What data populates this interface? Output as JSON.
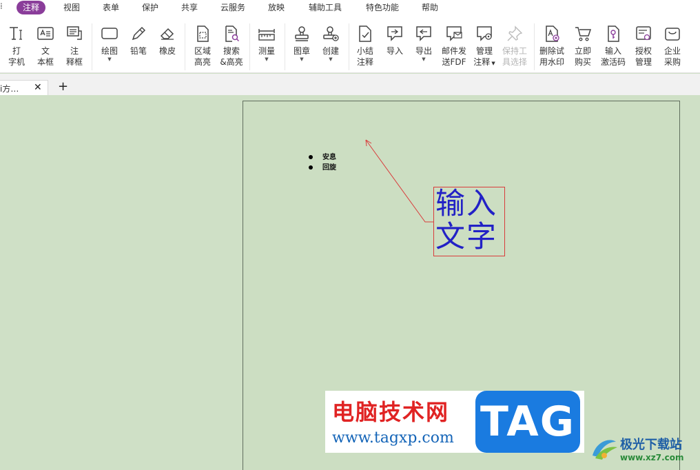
{
  "menu": {
    "items": [
      {
        "label": "注释",
        "active": true
      },
      {
        "label": "视图"
      },
      {
        "label": "表单"
      },
      {
        "label": "保护"
      },
      {
        "label": "共享"
      },
      {
        "label": "云服务"
      },
      {
        "label": "放映"
      },
      {
        "label": "辅助工具"
      },
      {
        "label": "特色功能"
      },
      {
        "label": "帮助"
      }
    ],
    "active_color": "#8a3d9a"
  },
  "ribbon": {
    "typewriter": {
      "line1": "打",
      "line2": "字机",
      "icon": "typewriter-icon"
    },
    "textbox": {
      "line1": "文",
      "line2": "本框",
      "icon": "textbox-icon"
    },
    "note": {
      "line1": "注",
      "line2": "释框",
      "icon": "callout-icon"
    },
    "draw": {
      "label": "绘图",
      "icon": "rectangle-icon"
    },
    "pencil": {
      "label": "铅笔",
      "icon": "pencil-icon"
    },
    "eraser": {
      "label": "橡皮",
      "icon": "eraser-icon"
    },
    "area_highlight": {
      "line1": "区域",
      "line2": "高亮",
      "icon": "area-highlight-icon"
    },
    "search_highlight": {
      "line1": "搜索",
      "line2": "&高亮",
      "icon": "search-highlight-icon"
    },
    "measure": {
      "label": "测量",
      "icon": "ruler-icon"
    },
    "stamp": {
      "label": "图章",
      "icon": "stamp-icon"
    },
    "create": {
      "label": "创建",
      "icon": "create-stamp-icon"
    },
    "summary": {
      "line1": "小结",
      "line2": "注释",
      "icon": "summary-icon"
    },
    "import": {
      "label": "导入",
      "icon": "import-icon"
    },
    "export": {
      "label": "导出",
      "icon": "export-icon"
    },
    "email_fdf": {
      "line1": "邮件发",
      "line2": "送FDF",
      "icon": "email-icon"
    },
    "manage": {
      "line1": "管理",
      "line2": "注释",
      "icon": "manage-icon"
    },
    "keep_tool": {
      "line1": "保持工",
      "line2": "具选择",
      "icon": "pin-icon"
    },
    "remove_watermark": {
      "line1": "删除试",
      "line2": "用水印",
      "icon": "remove-watermark-icon"
    },
    "buy": {
      "line1": "立即",
      "line2": "购买",
      "icon": "cart-icon"
    },
    "activation": {
      "line1": "输入",
      "line2": "激活码",
      "icon": "key-icon"
    },
    "license": {
      "line1": "授权",
      "line2": "管理",
      "icon": "license-icon"
    },
    "enterprise": {
      "line1": "企业",
      "line2": "采购",
      "icon": "bag-icon"
    }
  },
  "tabs": {
    "doc_title": "i方…",
    "close": "✕",
    "new_tab": "+"
  },
  "document": {
    "bullets": [
      "安息",
      "回旋"
    ],
    "callout_text": "输入文字",
    "callout_text_color": "#2221c6",
    "callout_border_color": "#d93b3b",
    "page_background": "#ccdec2"
  },
  "watermark": {
    "title": "电脑技术网",
    "url": "www.tagxp.com",
    "tag": "TAG",
    "corner_title": "极光下载站",
    "corner_url": "www.xz7.com"
  }
}
